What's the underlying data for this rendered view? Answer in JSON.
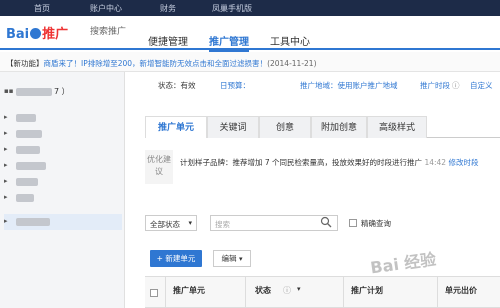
{
  "topnav": {
    "items": [
      "首页",
      "账户中心",
      "财务",
      "凤巢手机版"
    ]
  },
  "header": {
    "logo": "Bai",
    "logo_accent": "推广",
    "logo_sub": "搜索推广",
    "tabs": [
      "便捷管理",
      "推广管理",
      "工具中心"
    ]
  },
  "notice": {
    "label": "【新功能】",
    "link_text": "商盾来了！IP排除增至200，新增智能防无效点击和全面过滤损害！",
    "date": "(2014-11-21)"
  },
  "sidebar": {
    "first_suffix": "7 ）"
  },
  "status": {
    "state_label": "状态：有效",
    "budget": "日预算：",
    "region": "推广地域：使用账户推广地域",
    "period": "推广时段",
    "custom": "自定义"
  },
  "tabs2": [
    "推广单元",
    "关键词",
    "创意",
    "附加创意",
    "高级样式"
  ],
  "optimize": {
    "label": "优化建议",
    "text": "计划样子品牌：推荐增加 7 个同民检索量高，投放效果好的时段进行推广",
    "time": "14:42",
    "action": "修改时段"
  },
  "filter": {
    "status_select": "全部状态",
    "search_placeholder": "搜索",
    "exact_query": "精确查询"
  },
  "actions": {
    "new_unit": "+ 新建单元",
    "edit": "编辑"
  },
  "table": {
    "headers": [
      "推广单元",
      "状态",
      "推广计划",
      "单元出价"
    ]
  },
  "watermark": "Bai 经验"
}
